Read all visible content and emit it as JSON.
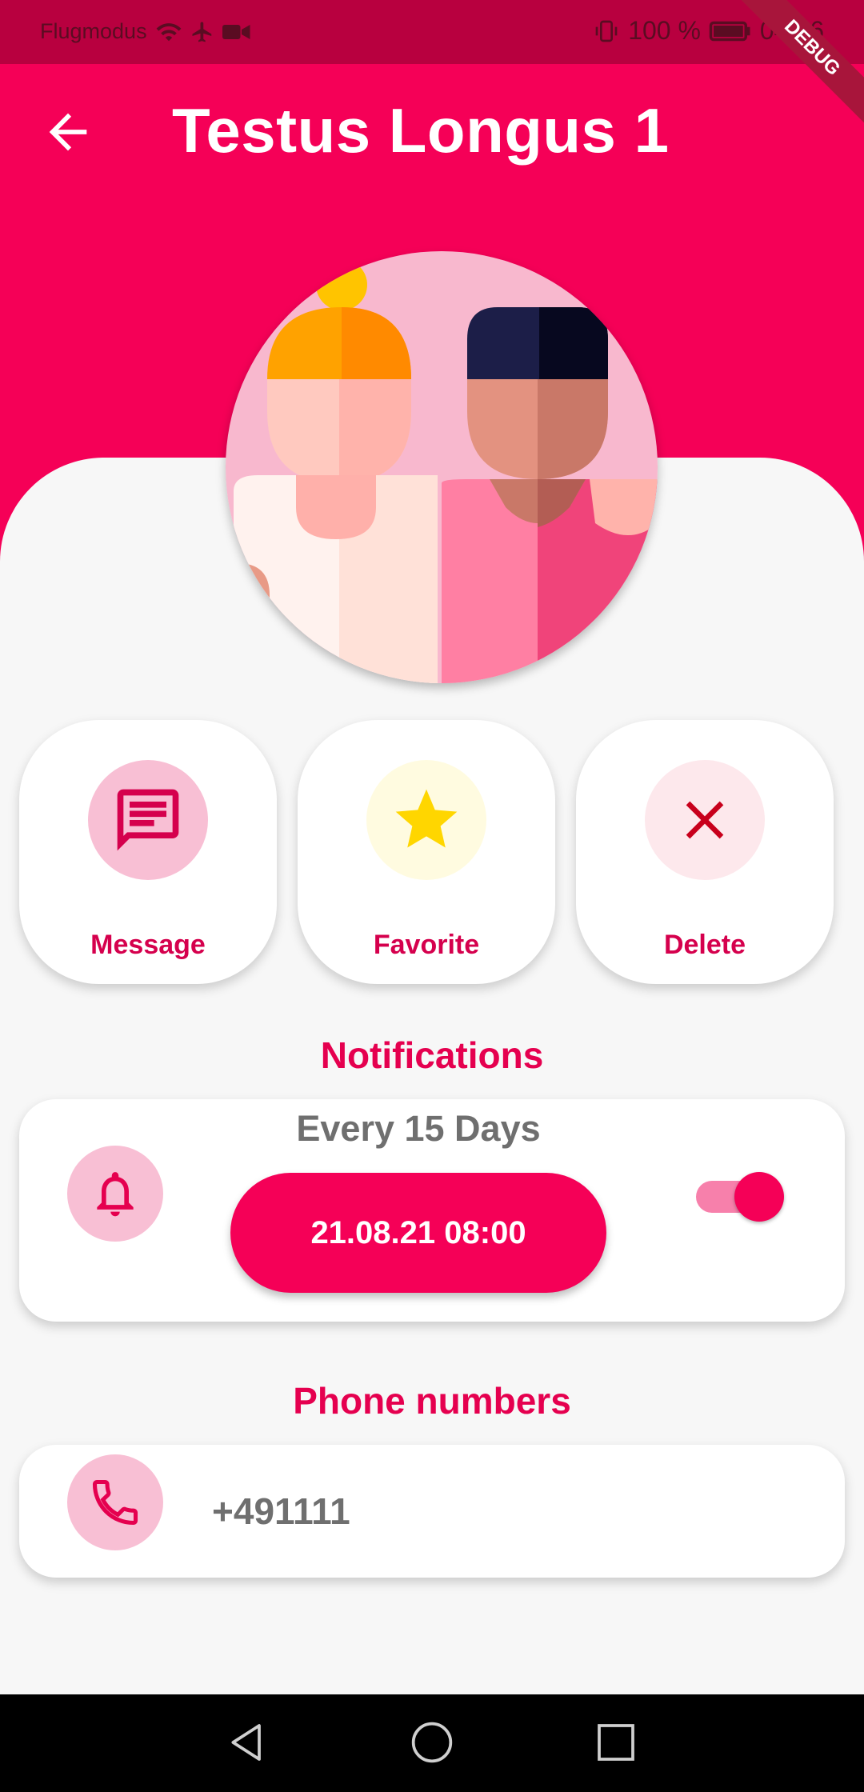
{
  "status_bar": {
    "carrier_text": "Flugmodus",
    "battery": "100 %",
    "time": "04:06"
  },
  "debug_banner": "DEBUG",
  "header": {
    "title": "Testus Longus 1"
  },
  "actions": [
    {
      "label": "Message",
      "icon": "message-icon"
    },
    {
      "label": "Favorite",
      "icon": "star-icon"
    },
    {
      "label": "Delete",
      "icon": "close-icon"
    }
  ],
  "notifications": {
    "section_title": "Notifications",
    "frequency": "Every 15 Days",
    "next_date": "21.08.21 08:00",
    "enabled": true
  },
  "phones": {
    "section_title": "Phone numbers",
    "items": [
      {
        "number": "+491111"
      }
    ]
  },
  "colors": {
    "primary": "#f50057",
    "status_bar": "#b8003f",
    "accent_light": "#f8bfd4"
  }
}
